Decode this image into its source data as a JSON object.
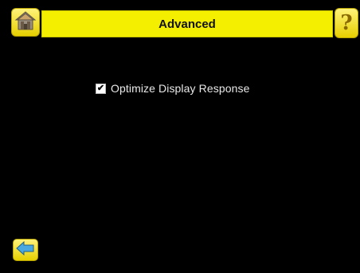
{
  "header": {
    "title": "Advanced",
    "home_icon": "home-icon",
    "help_icon": "help-icon",
    "help_glyph": "?"
  },
  "options": [
    {
      "label": "Optimize Display Response",
      "checked": true
    }
  ],
  "footer": {
    "back_icon": "back-arrow-icon"
  },
  "colors": {
    "background": "#000000",
    "title_bar": "#f4ee00",
    "button": "#f0dc10",
    "text": "#e8e8e8"
  }
}
